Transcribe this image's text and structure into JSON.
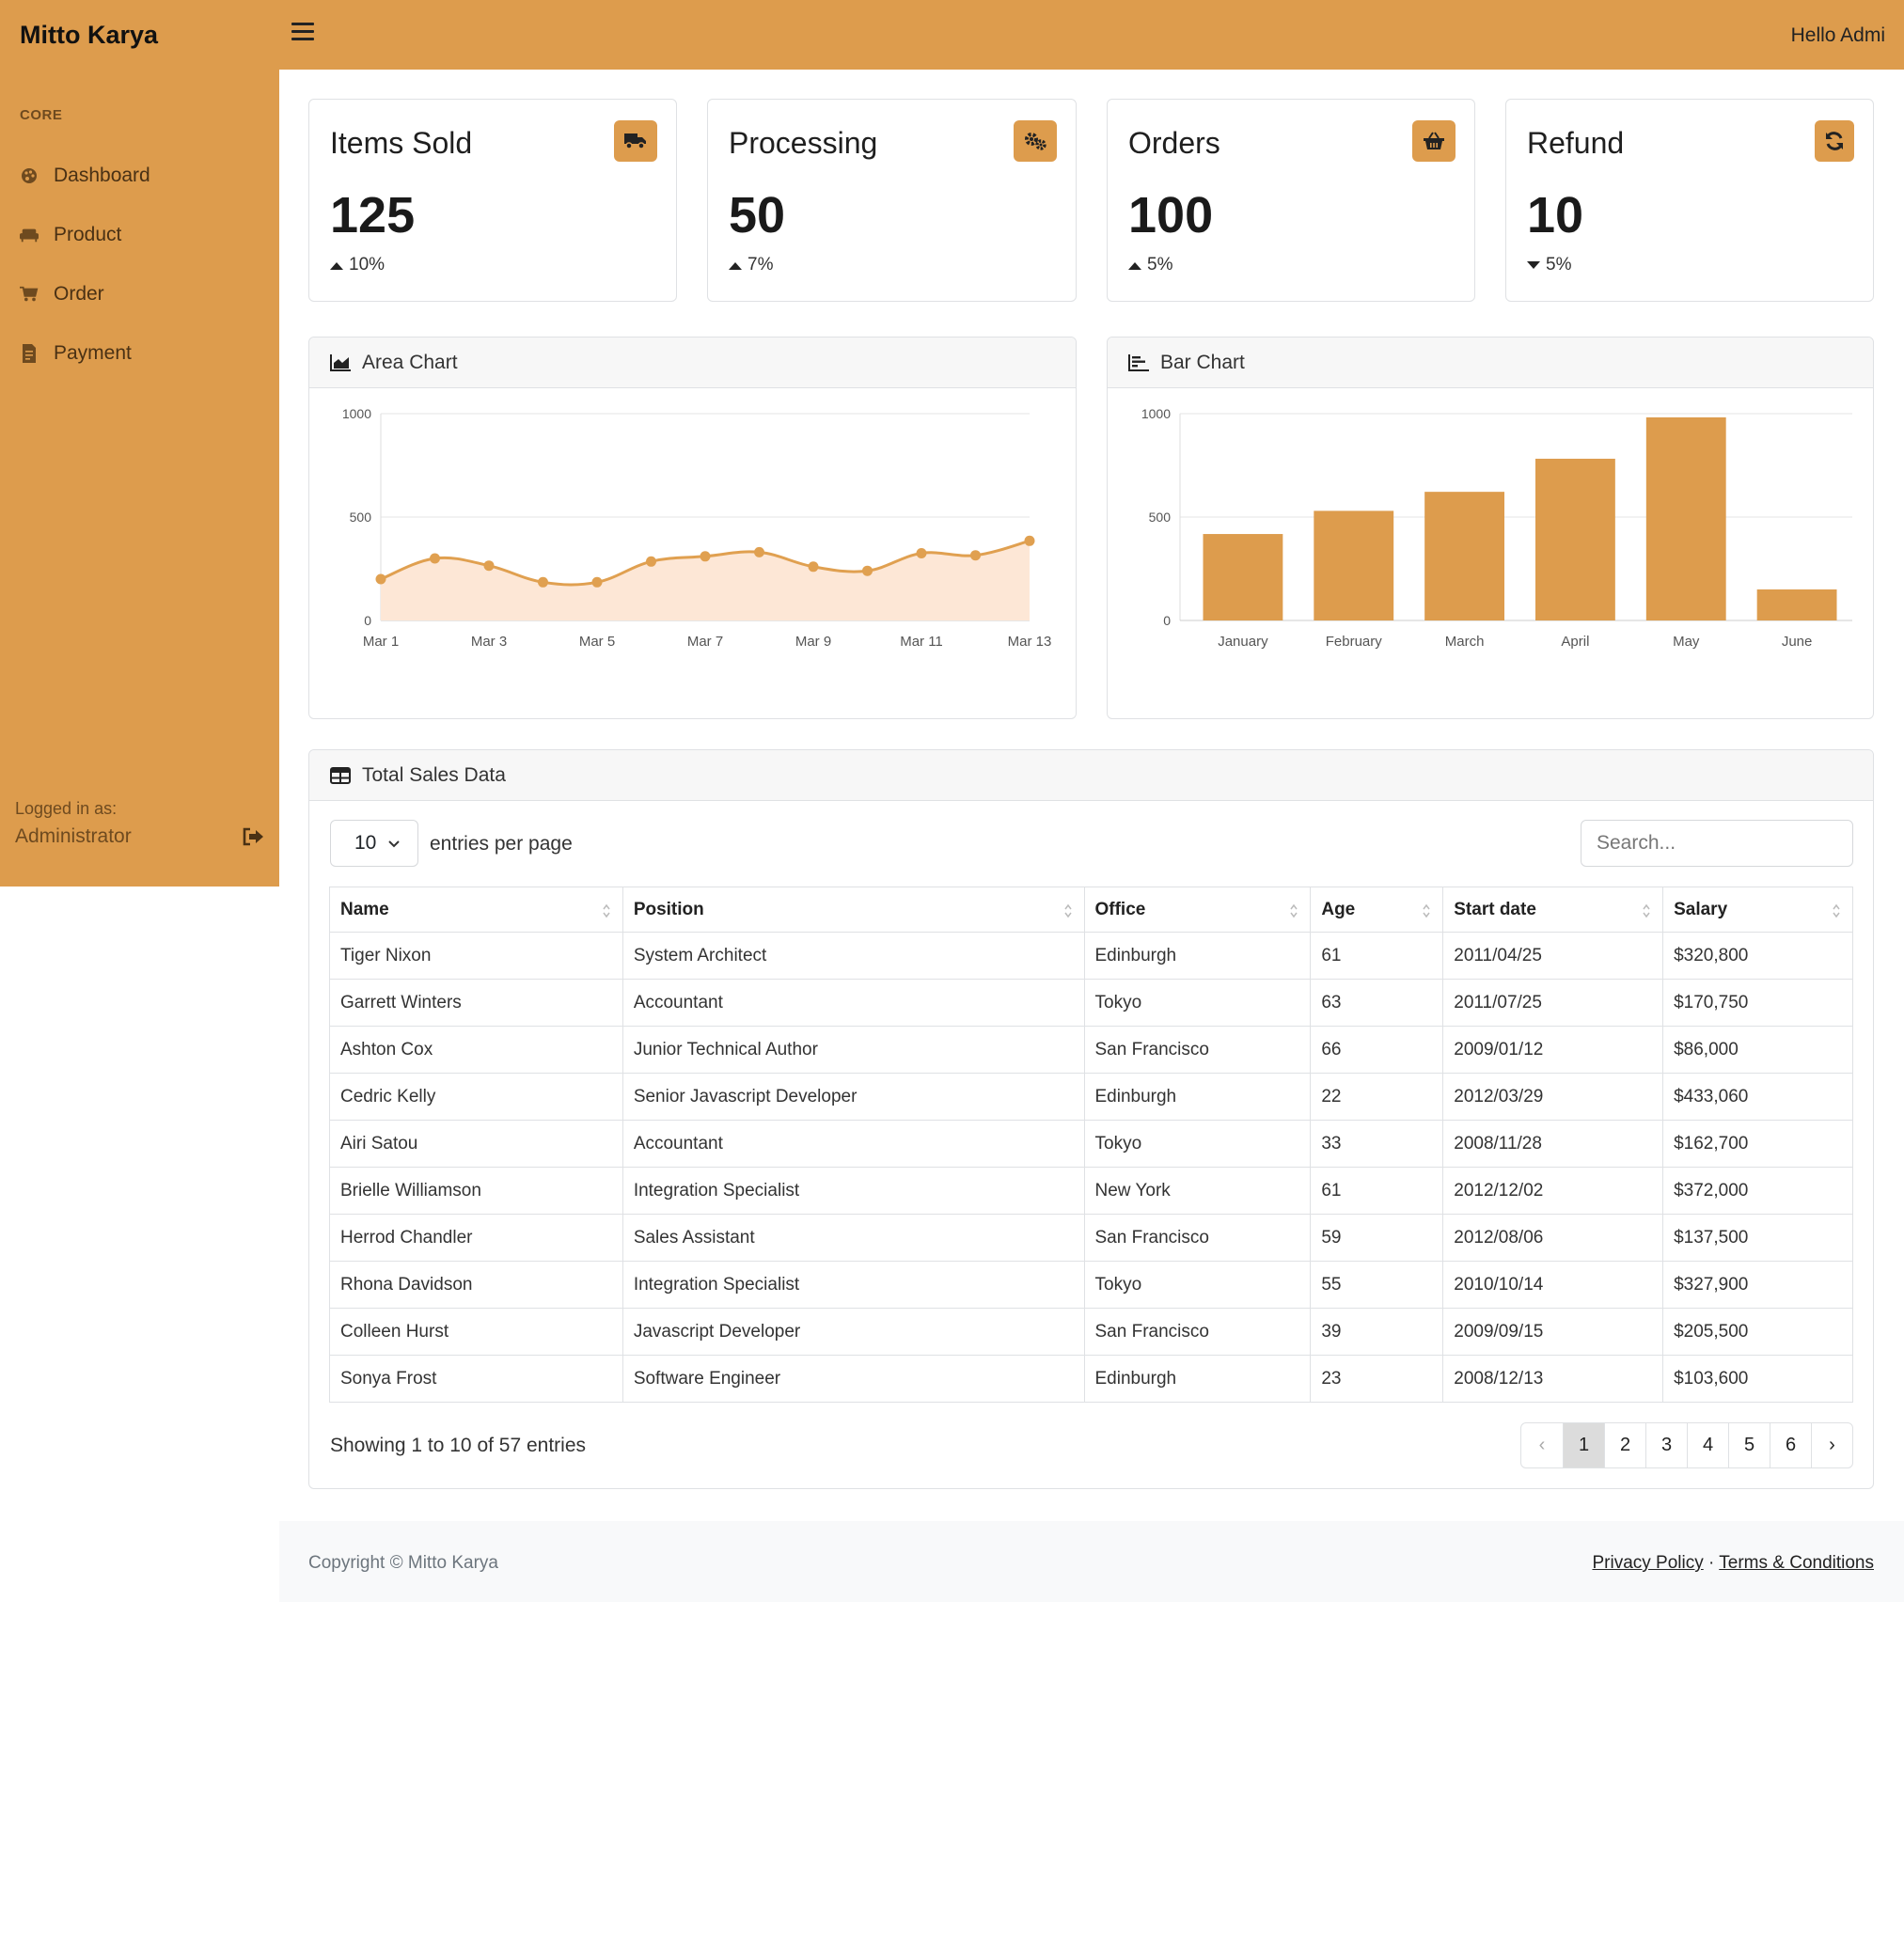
{
  "app": {
    "brand": "Mitto Karya",
    "greeting": "Hello Admi"
  },
  "sidebar": {
    "heading": "CORE",
    "items": [
      {
        "label": "Dashboard",
        "icon": "palette-icon"
      },
      {
        "label": "Product",
        "icon": "couch-icon"
      },
      {
        "label": "Order",
        "icon": "cart-icon"
      },
      {
        "label": "Payment",
        "icon": "receipt-icon"
      }
    ],
    "logged_in_label": "Logged in as:",
    "user": "Administrator"
  },
  "stats": [
    {
      "title": "Items Sold",
      "value": "125",
      "change": "10%",
      "direction": "up",
      "icon": "truck-icon"
    },
    {
      "title": "Processing",
      "value": "50",
      "change": "7%",
      "direction": "up",
      "icon": "gears-icon"
    },
    {
      "title": "Orders",
      "value": "100",
      "change": "5%",
      "direction": "up",
      "icon": "basket-icon"
    },
    {
      "title": "Refund",
      "value": "10",
      "direction": "down",
      "change": "5%",
      "icon": "refresh-icon"
    }
  ],
  "colors": {
    "accent": "#dd9c4d",
    "area_fill": "#fde7d6",
    "line": "#e0a050"
  },
  "chart_data": [
    {
      "type": "area",
      "title": "Area Chart",
      "x": [
        "Mar 1",
        "Mar 2",
        "Mar 3",
        "Mar 4",
        "Mar 5",
        "Mar 6",
        "Mar 7",
        "Mar 8",
        "Mar 9",
        "Mar 10",
        "Mar 11",
        "Mar 12",
        "Mar 13"
      ],
      "x_tick_labels": [
        "Mar 1",
        "Mar 3",
        "Mar 5",
        "Mar 7",
        "Mar 9",
        "Mar 11",
        "Mar 13"
      ],
      "values": [
        200,
        300,
        265,
        185,
        185,
        285,
        310,
        330,
        260,
        240,
        325,
        315,
        385
      ],
      "ylim": [
        0,
        1000
      ],
      "yticks": [
        0,
        500,
        1000
      ],
      "grid": true
    },
    {
      "type": "bar",
      "title": "Bar Chart",
      "categories": [
        "January",
        "February",
        "March",
        "April",
        "May",
        "June"
      ],
      "values": [
        418,
        530,
        622,
        782,
        982,
        150
      ],
      "ylim": [
        0,
        1000
      ],
      "yticks": [
        0,
        500,
        1000
      ],
      "grid": true
    }
  ],
  "table": {
    "title": "Total Sales Data",
    "page_size": "10",
    "per_page_label": "entries per page",
    "search_placeholder": "Search...",
    "columns": [
      "Name",
      "Position",
      "Office",
      "Age",
      "Start date",
      "Salary"
    ],
    "rows": [
      [
        "Tiger Nixon",
        "System Architect",
        "Edinburgh",
        "61",
        "2011/04/25",
        "$320,800"
      ],
      [
        "Garrett Winters",
        "Accountant",
        "Tokyo",
        "63",
        "2011/07/25",
        "$170,750"
      ],
      [
        "Ashton Cox",
        "Junior Technical Author",
        "San Francisco",
        "66",
        "2009/01/12",
        "$86,000"
      ],
      [
        "Cedric Kelly",
        "Senior Javascript Developer",
        "Edinburgh",
        "22",
        "2012/03/29",
        "$433,060"
      ],
      [
        "Airi Satou",
        "Accountant",
        "Tokyo",
        "33",
        "2008/11/28",
        "$162,700"
      ],
      [
        "Brielle Williamson",
        "Integration Specialist",
        "New York",
        "61",
        "2012/12/02",
        "$372,000"
      ],
      [
        "Herrod Chandler",
        "Sales Assistant",
        "San Francisco",
        "59",
        "2012/08/06",
        "$137,500"
      ],
      [
        "Rhona Davidson",
        "Integration Specialist",
        "Tokyo",
        "55",
        "2010/10/14",
        "$327,900"
      ],
      [
        "Colleen Hurst",
        "Javascript Developer",
        "San Francisco",
        "39",
        "2009/09/15",
        "$205,500"
      ],
      [
        "Sonya Frost",
        "Software Engineer",
        "Edinburgh",
        "23",
        "2008/12/13",
        "$103,600"
      ]
    ],
    "showing": "Showing 1 to 10 of 57 entries",
    "pages": [
      "‹",
      "1",
      "2",
      "3",
      "4",
      "5",
      "6",
      "›"
    ],
    "current_page": "1"
  },
  "footer": {
    "copyright": "Copyright © Mitto Karya",
    "privacy": "Privacy Policy",
    "separator": "·",
    "terms": "Terms & Conditions"
  }
}
